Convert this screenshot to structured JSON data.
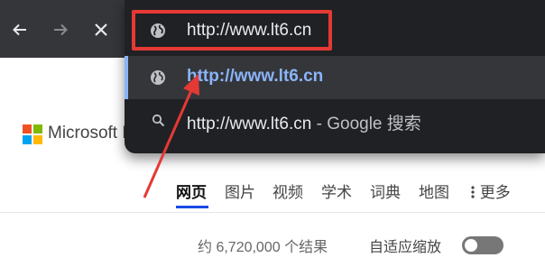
{
  "browser": {
    "icons": [
      "back-icon",
      "forward-icon",
      "stop-icon",
      "globe-icon",
      "search-icon"
    ],
    "omnibox": {
      "value": "http://www.lt6.cn"
    },
    "suggestions": [
      {
        "url": "http://www.lt6.cn",
        "icon": "globe-icon",
        "selected": true
      },
      {
        "url": "http://www.lt6.cn",
        "separator": " - ",
        "engine_text": "Google 搜索",
        "icon": "search-icon"
      }
    ],
    "accent_color": "#8ab4f8",
    "highlight_color": "#e53935"
  },
  "page": {
    "logo_text": "Microsoft B",
    "tabs": [
      {
        "label": "网页",
        "active": true
      },
      {
        "label": "图片"
      },
      {
        "label": "视频"
      },
      {
        "label": "学术"
      },
      {
        "label": "词典"
      },
      {
        "label": "地图"
      },
      {
        "label": "更多",
        "icon": "more-vert-icon"
      }
    ],
    "results_count": "约 6,720,000 个结果",
    "adaptive_zoom_label": "自适应缩放",
    "adaptive_zoom_on": false
  }
}
